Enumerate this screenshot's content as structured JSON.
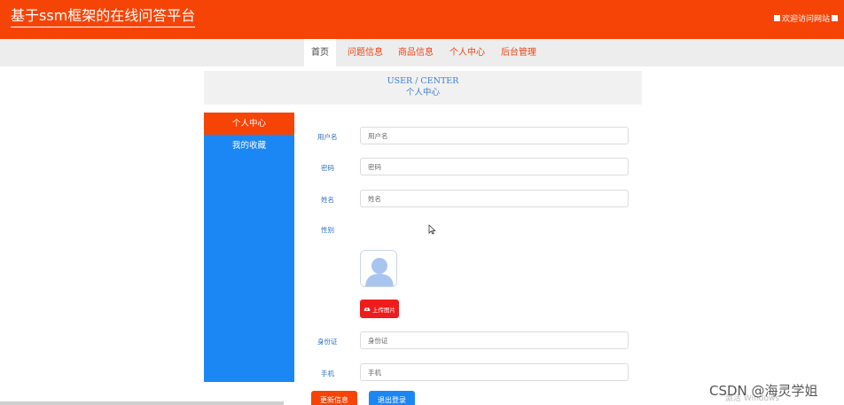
{
  "header": {
    "site_title": "基于ssm框架的在线问答平台",
    "welcome_text": "欢迎访问网站"
  },
  "nav": {
    "items": [
      {
        "label": "首页",
        "active": true
      },
      {
        "label": "问题信息",
        "active": false
      },
      {
        "label": "商品信息",
        "active": false
      },
      {
        "label": "个人中心",
        "active": false
      },
      {
        "label": "后台管理",
        "active": false
      }
    ]
  },
  "banner": {
    "title_en": "USER / CENTER",
    "title_cn": "个人中心"
  },
  "sidebar": {
    "items": [
      {
        "label": "个人中心",
        "active": true
      },
      {
        "label": "我的收藏",
        "active": false
      }
    ]
  },
  "form": {
    "username": {
      "label": "用户名",
      "placeholder": "用户名",
      "value": ""
    },
    "password": {
      "label": "密码",
      "placeholder": "密码",
      "value": ""
    },
    "name": {
      "label": "姓名",
      "placeholder": "姓名",
      "value": ""
    },
    "gender": {
      "label": "性别"
    },
    "upload_label": "上传图片",
    "id_card": {
      "label": "身份证",
      "placeholder": "身份证",
      "value": ""
    },
    "phone": {
      "label": "手机",
      "placeholder": "手机",
      "value": ""
    }
  },
  "actions": {
    "update_label": "更新信息",
    "logout_label": "退出登录"
  },
  "overlay": {
    "activate_windows": "激活 Windows",
    "watermark": "CSDN @海灵学姐"
  },
  "colors": {
    "brand_orange": "#f64407",
    "sidebar_blue": "#1b87f5",
    "upload_red": "#ee1c1c",
    "label_blue": "#2f6fc0"
  }
}
